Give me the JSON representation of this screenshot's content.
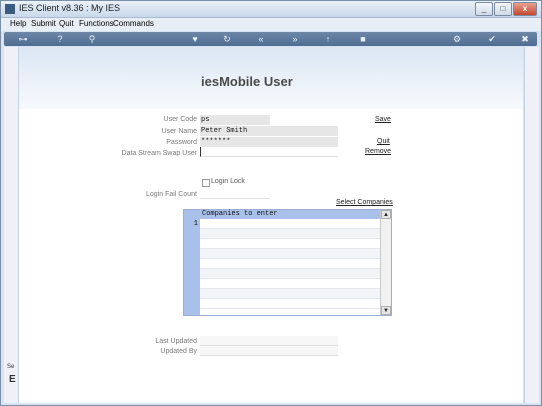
{
  "window": {
    "title": "IES Client v8.36 : My IES",
    "minimize_glyph": "_",
    "maximize_glyph": "□",
    "close_glyph": "x"
  },
  "menu": {
    "items": [
      "Help",
      "Submit",
      "Quit",
      "Functions",
      "Commands"
    ]
  },
  "toolbar": {
    "icons": [
      "key-icon",
      "help-icon",
      "search-icon",
      "heart-icon",
      "refresh-icon",
      "rewind-icon",
      "fast-forward-icon",
      "upload-icon",
      "stop-icon",
      "settings-icon",
      "check-icon",
      "close-icon"
    ],
    "glyphs": [
      "⊶",
      "?",
      "⚲",
      "♥",
      "↻",
      "«",
      "»",
      "↑",
      "■",
      "⚙",
      "✔",
      "✖"
    ]
  },
  "form": {
    "title": "iesMobile User",
    "user_code_label": "User Code",
    "user_code_value": "ps",
    "user_name_label": "User Name",
    "user_name_value": "Peter Smith",
    "password_label": "Password",
    "password_value": "*******",
    "swap_user_label": "Data Stream Swap User",
    "swap_user_value": "",
    "login_lock_label": "Login Lock",
    "login_fail_label": "Login Fail Count",
    "login_fail_value": "",
    "last_updated_label": "Last Updated",
    "last_updated_value": "",
    "updated_by_label": "Updated By",
    "updated_by_value": ""
  },
  "links": {
    "save": "Save",
    "quit": "Quit",
    "remove": "Remove",
    "select_companies": "Select Companies"
  },
  "companies": {
    "header": "Companies to enter",
    "row_number": "1",
    "scroll_up": "▲",
    "scroll_down": "▼"
  },
  "left_stub": {
    "line1": "Se",
    "line2": "E"
  }
}
